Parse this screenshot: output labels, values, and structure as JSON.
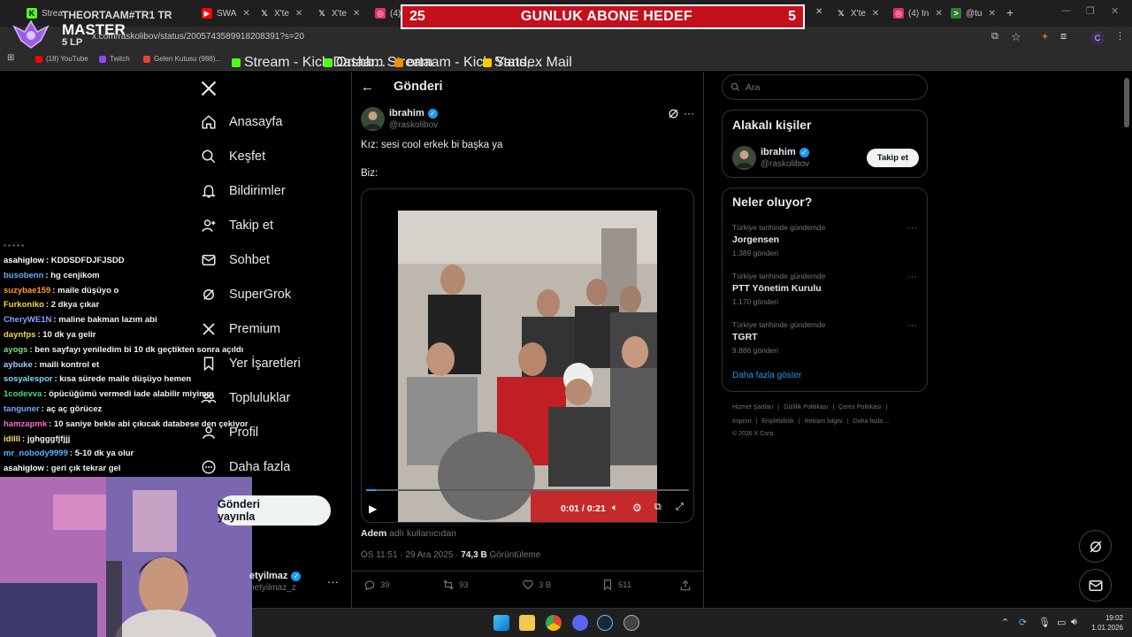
{
  "tabs": [
    {
      "label": "Strea",
      "icon": "kick-icon",
      "color": "#53fc18"
    },
    {
      "label": "SWA",
      "icon": "youtube-icon",
      "color": "#ff0000"
    },
    {
      "label": "X'te",
      "icon": "x-icon",
      "color": "#ffffff"
    },
    {
      "label": "X'te",
      "icon": "x-icon",
      "color": "#ffffff"
    },
    {
      "label": "(4)",
      "icon": "instagram-icon",
      "color": "#e1306c"
    },
    {
      "label": "X'te",
      "icon": "x-icon",
      "color": "#ffffff"
    },
    {
      "label": "(4) In",
      "icon": "instagram-icon",
      "color": "#e1306c"
    },
    {
      "label": "@tu",
      "icon": "terminal-icon",
      "color": "#4caf50"
    }
  ],
  "browser": {
    "url": "x.com/raskolibov/status/2005743589918208391?s=20",
    "bookmarks": [
      {
        "label": "(18) YouTube",
        "color": "#ff0000"
      },
      {
        "label": "Twitch",
        "color": "#9146ff"
      },
      {
        "label": "Gelen Kutusu (988)...",
        "color": "#ea4335"
      },
      {
        "label": "Stream - Kick Dashb...",
        "color": "#53fc18"
      },
      {
        "label": "Ortaam Stream",
        "color": "#53fc18"
      },
      {
        "label": "ortaam - Kick Stats,...",
        "color": "#ff8a00"
      },
      {
        "label": "Yandex Mail",
        "color": "#ffcc00"
      }
    ],
    "profile_initial": "C"
  },
  "overlay": {
    "banner_left": "25",
    "banner_title": "GUNLUK ABONE HEDEF",
    "banner_right": "5",
    "rank_user": "THEORTAAM#TR1 TR",
    "rank_title": "MASTER",
    "rank_lp": "5 LP"
  },
  "chat": [
    {
      "user": "asahiglow",
      "msg": "KDDSDFDJFJSDD",
      "color": "#ffffff"
    },
    {
      "user": "busobenn",
      "msg": "hg cenjikom",
      "color": "#5ab4ff"
    },
    {
      "user": "suzybae159",
      "msg": "maile düşüyo o",
      "color": "#ff9f1c"
    },
    {
      "user": "Furkoniko",
      "msg": "2 dkya çıkar",
      "color": "#f5d742"
    },
    {
      "user": "CheryWE1N",
      "msg": "maline bakman lazım abi",
      "color": "#7aa8ff"
    },
    {
      "user": "daynfps",
      "msg": "10 dk ya gelir",
      "color": "#f5d742"
    },
    {
      "user": "ayogs",
      "msg": "ben sayfayı yeniledim bi 10 dk geçtikten sonra açıldı",
      "color": "#7ee081"
    },
    {
      "user": "aybuke",
      "msg": "maili kontrol et",
      "color": "#9ecbff"
    },
    {
      "user": "sosyalespor",
      "msg": "kısa sürede maile düşüyo hemen",
      "color": "#7fd6ff"
    },
    {
      "user": "1codevva",
      "msg": "öpücüğümü vermedi iade alabilir miyimm",
      "color": "#3ddc84"
    },
    {
      "user": "tanguner",
      "msg": "aç aç görücez",
      "color": "#7aa8ff"
    },
    {
      "user": "hamzapmk",
      "msg": "10 saniye bekle abi çıkıcak databese den çekiyor",
      "color": "#ff6ad5"
    },
    {
      "user": "idilll",
      "msg": "jghgggfjfjjj",
      "color": "#ffe066"
    },
    {
      "user": "mr_nobody9999",
      "msg": "5-10 dk ya olur",
      "color": "#5ab4ff"
    },
    {
      "user": "asahiglow",
      "msg": "geri çık tekrar gel",
      "color": "#ffffff"
    }
  ],
  "nav": [
    {
      "label": "Anasayfa",
      "icon": "home-icon"
    },
    {
      "label": "Keşfet",
      "icon": "search-icon"
    },
    {
      "label": "Bildirimler",
      "icon": "bell-icon"
    },
    {
      "label": "Takip et",
      "icon": "follow-icon"
    },
    {
      "label": "Sohbet",
      "icon": "mail-icon"
    },
    {
      "label": "SuperGrok",
      "icon": "grok-icon"
    },
    {
      "label": "Premium",
      "icon": "x-premium-icon"
    },
    {
      "label": "Yer İşaretleri",
      "icon": "bookmark-icon"
    },
    {
      "label": "Topluluklar",
      "icon": "communities-icon"
    },
    {
      "label": "Profil",
      "icon": "profile-icon"
    },
    {
      "label": "Daha fazla",
      "icon": "more-circle-icon"
    }
  ],
  "post_button": "Gönderi yayınla",
  "account": {
    "name": "etyilmaz",
    "handle": "netyilmaz_z"
  },
  "post": {
    "header": "Gönderi",
    "author_name": "ibrahim",
    "author_handle": "@raskolibov",
    "text_line1": "Kız: sesi cool erkek bi başka ya",
    "text_line2": "Biz:",
    "video_time": "0:01 / 0:21",
    "video_progress": 0.03,
    "attribution_name": "Adem",
    "attribution_rest": "adlı kullanıcıdan",
    "timestamp": "ÖS 11:51 · 29 Ara 2025 · ",
    "views_count": "74,3 B",
    "views_label": "Görüntüleme",
    "replies": "39",
    "reposts": "93",
    "likes": "3 B",
    "bookmarks": "511"
  },
  "search": {
    "placeholder": "Ara"
  },
  "related": {
    "title": "Alakalı kişiler",
    "name": "ibrahim",
    "handle": "@raskolibov",
    "follow_label": "Takip et"
  },
  "trends": {
    "title": "Neler oluyor?",
    "items": [
      {
        "context": "Türkiye tarihinde gündemde",
        "name": "Jorgensen",
        "count": "1.389 gönderi"
      },
      {
        "context": "Türkiye tarihinde gündemde",
        "name": "PTT Yönetim Kurulu",
        "count": "1.170 gönderi"
      },
      {
        "context": "Türkiye tarihinde gündemde",
        "name": "TGRT",
        "count": "9.886 gönderi"
      }
    ],
    "show_more": "Daha fazla göster"
  },
  "footer": {
    "line1": [
      "Hizmet Şartları",
      "Gizlilik Politikası",
      "Çerez Politikası"
    ],
    "line2": [
      "Imprint",
      "Erişilebilirlik",
      "Reklam bilgisi",
      "Daha fazla ..."
    ],
    "copyright": "© 2026 X Corp."
  },
  "taskbar": {
    "time": "19:02",
    "date": "1.01.2026"
  },
  "colors": {
    "accent": "#1d9bf0",
    "banner_red": "#c4101d",
    "bg": "#000000",
    "border": "#2f3336"
  }
}
